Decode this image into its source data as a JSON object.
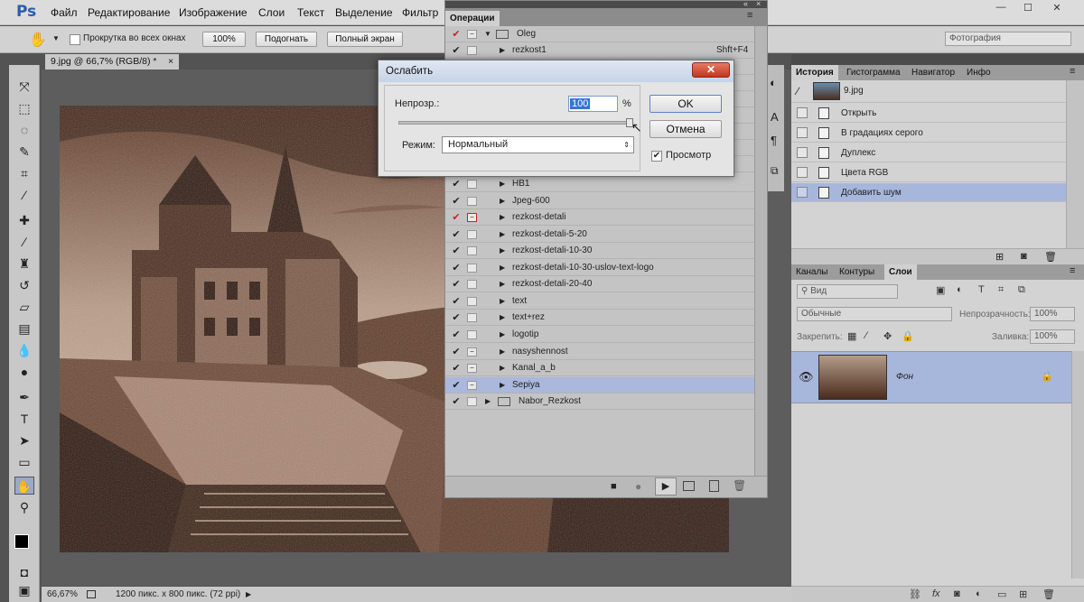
{
  "app": {
    "logo": "Ps"
  },
  "menu": [
    "Файл",
    "Редактирование",
    "Изображение",
    "Слои",
    "Текст",
    "Выделение",
    "Фильтр"
  ],
  "window_controls": {
    "minimize": "—",
    "maximize": "☐",
    "close": "✕"
  },
  "options_bar": {
    "scroll_all_label": "Прокрутка во всех окнах",
    "btn_100": "100%",
    "btn_fit": "Подогнать",
    "btn_fullscreen": "Полный экран",
    "workspace": "Фотография"
  },
  "document": {
    "tab_title": "9.jpg @ 66,7% (RGB/8) *",
    "zoom": "66,67%",
    "size_info": "1200 пикс. x 800 пикс. (72 ppi)"
  },
  "actions_panel": {
    "title": "Операции",
    "set_name": "Oleg",
    "shortcut": "Shft+F4",
    "items": [
      {
        "label": "rezkost1",
        "red": false,
        "box": ""
      },
      {
        "label": "HB1",
        "red": false,
        "box": ""
      },
      {
        "label": "Jpeg-600",
        "red": false,
        "box": ""
      },
      {
        "label": "rezkost-detali",
        "red": true,
        "box": "−"
      },
      {
        "label": "rezkost-detali-5-20",
        "red": false,
        "box": ""
      },
      {
        "label": "rezkost-detali-10-30",
        "red": false,
        "box": ""
      },
      {
        "label": "rezkost-detali-10-30-uslov-text-logo",
        "red": false,
        "box": ""
      },
      {
        "label": "rezkost-detali-20-40",
        "red": false,
        "box": ""
      },
      {
        "label": "text",
        "red": false,
        "box": ""
      },
      {
        "label": "text+rez",
        "red": false,
        "box": ""
      },
      {
        "label": "logotip",
        "red": false,
        "box": ""
      },
      {
        "label": "nasyshennost",
        "red": false,
        "box": "−"
      },
      {
        "label": "Kanal_a_b",
        "red": false,
        "box": "−"
      },
      {
        "label": "Sepiya",
        "red": false,
        "box": "−"
      }
    ],
    "set2_name": "Nabor_Rezkost"
  },
  "dialog": {
    "title": "Ослабить",
    "close": "✕",
    "opacity_label": "Непрозр.:",
    "opacity_value": "100",
    "percent": "%",
    "mode_label": "Режим:",
    "mode_value": "Нормальный",
    "ok": "OK",
    "cancel": "Отмена",
    "preview": "Просмотр"
  },
  "history_panel": {
    "tabs": [
      "История",
      "Гистограмма",
      "Навигатор",
      "Инфо"
    ],
    "snapshot": "9.jpg",
    "items": [
      "Открыть",
      "В градациях серого",
      "Дуплекс",
      "Цвета RGB",
      "Добавить шум"
    ]
  },
  "layers_panel": {
    "tabs": [
      "Каналы",
      "Контуры",
      "Слои"
    ],
    "kind_placeholder": "Вид",
    "blend_mode": "Обычные",
    "opacity_label": "Непрозрачность:",
    "opacity_value": "100%",
    "lock_label": "Закрепить:",
    "fill_label": "Заливка:",
    "fill_value": "100%",
    "layer_name": "Фон"
  },
  "colors": {
    "sepia_dark": "#3a1f12",
    "sepia_light": "#d9c2ae",
    "selection": "#a7b6db"
  }
}
